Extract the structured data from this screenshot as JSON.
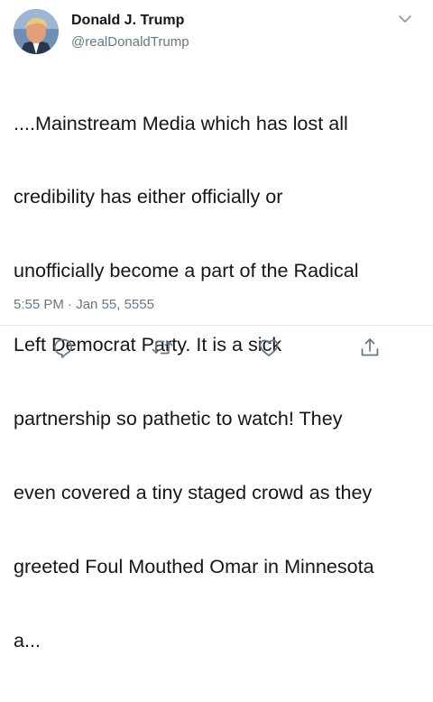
{
  "author": {
    "name": "Donald J. Trump",
    "handle": "@realDonaldTrump"
  },
  "tweet": {
    "lines": [
      "....Mainstream Media which has lost all",
      "credibility has either officially or",
      "unofficially become a part of the Radical",
      "Left Democrat Party. It is a sick",
      "partnership so pathetic to watch! They",
      "even covered a tiny staged crowd as they",
      "greeted Foul Mouthed Omar in Minnesota",
      "a..."
    ],
    "timestamp": "5:55 PM · Jan 55, 5555"
  },
  "icons": {
    "menu": "chevron-down-icon",
    "reply": "reply-icon",
    "retweet": "retweet-icon",
    "like": "heart-icon",
    "share": "share-icon"
  },
  "colors": {
    "text": "#14171a",
    "secondary": "#657786",
    "icon": "#657786",
    "divider": "#e6ecf0"
  }
}
